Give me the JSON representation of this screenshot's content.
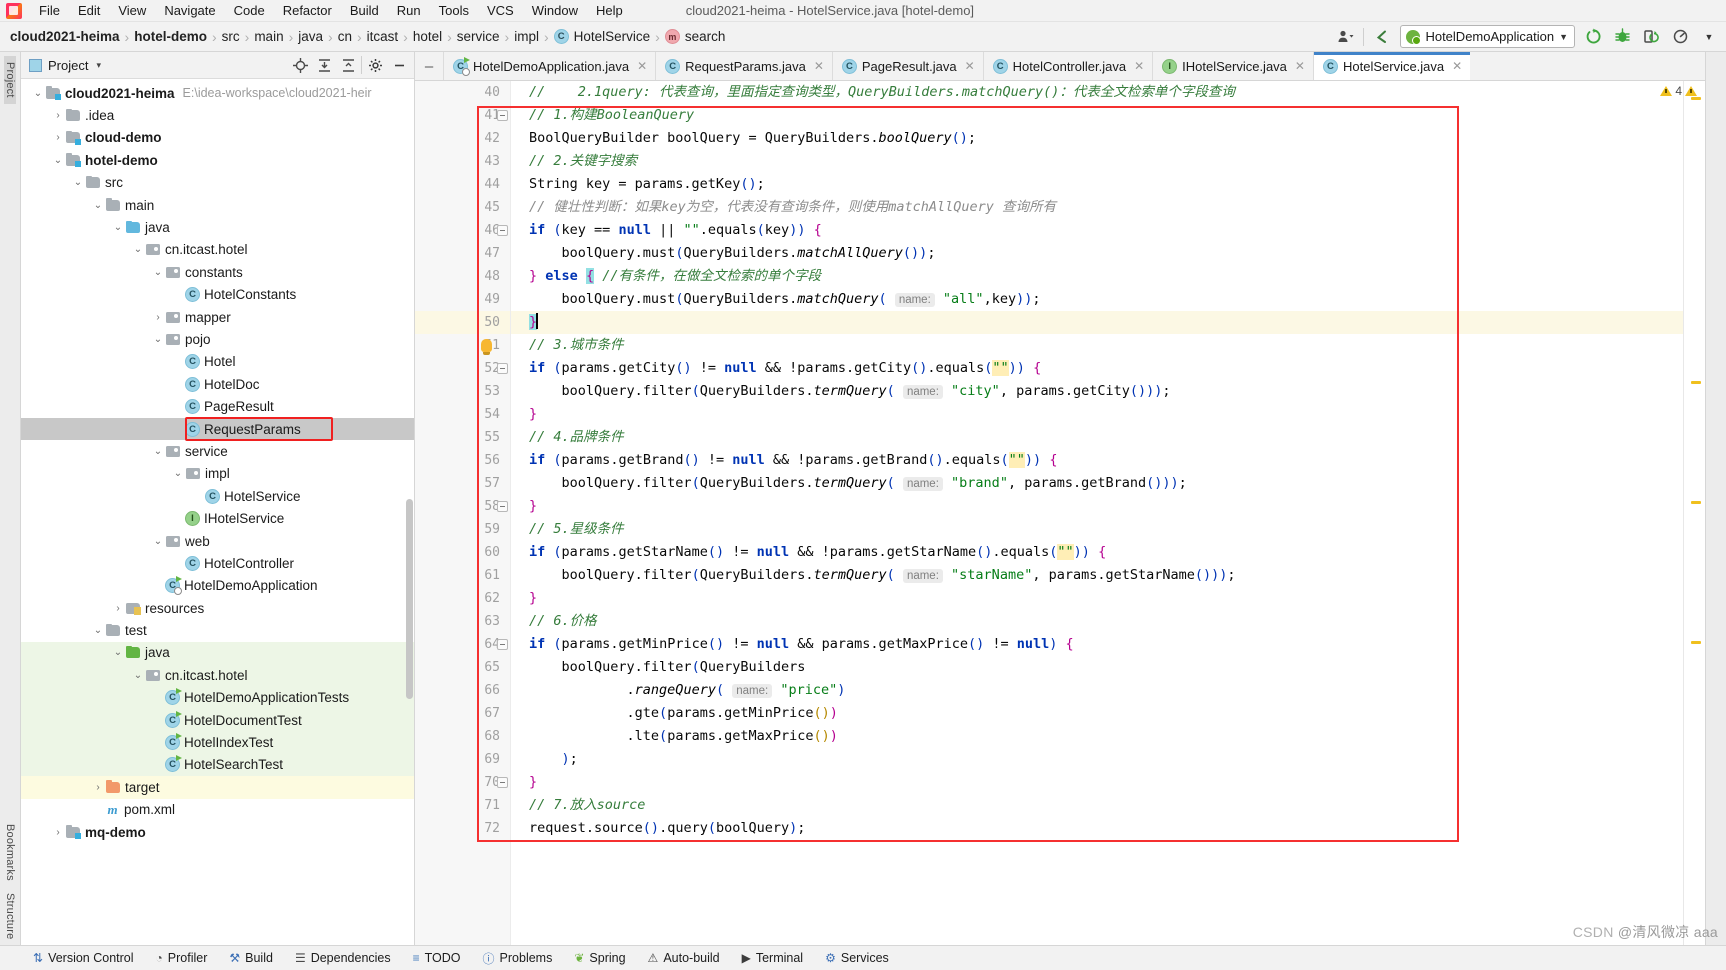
{
  "window": {
    "title": "cloud2021-heima - HotelService.java [hotel-demo]"
  },
  "menu": {
    "items": [
      "File",
      "Edit",
      "View",
      "Navigate",
      "Code",
      "Refactor",
      "Build",
      "Run",
      "Tools",
      "VCS",
      "Window",
      "Help"
    ]
  },
  "breadcrumb": {
    "items": [
      {
        "label": "cloud2021-heima",
        "bold": true,
        "icon": "none"
      },
      {
        "label": "hotel-demo",
        "bold": true,
        "icon": "none"
      },
      {
        "label": "src",
        "bold": false,
        "icon": "none"
      },
      {
        "label": "main",
        "bold": false,
        "icon": "none"
      },
      {
        "label": "java",
        "bold": false,
        "icon": "none"
      },
      {
        "label": "cn",
        "bold": false,
        "icon": "none"
      },
      {
        "label": "itcast",
        "bold": false,
        "icon": "none"
      },
      {
        "label": "hotel",
        "bold": false,
        "icon": "none"
      },
      {
        "label": "service",
        "bold": false,
        "icon": "none"
      },
      {
        "label": "impl",
        "bold": false,
        "icon": "none"
      },
      {
        "label": "HotelService",
        "bold": false,
        "icon": "class"
      },
      {
        "label": "search",
        "bold": false,
        "icon": "method"
      }
    ],
    "separator": "›"
  },
  "toolbar_right": {
    "run_configuration": "HotelDemoApplication",
    "dropdown_caret": "▼",
    "icons": [
      "user-dropdown-icon",
      "back-arrow-icon",
      "run-icon",
      "debug-icon",
      "run-coverage-icon",
      "profile-icon",
      "more-icon"
    ]
  },
  "project_panel": {
    "title": "Project",
    "dropdown_caret": "▾",
    "actions": [
      "locate-icon",
      "expand-all-icon",
      "collapse-all-icon",
      "settings-gear-icon",
      "hide-icon"
    ],
    "tree": [
      {
        "label": "cloud2021-heima",
        "indent": 0,
        "arrow": "⌄",
        "icon": "module",
        "bold": true,
        "path": "E:\\idea-workspace\\cloud2021-heir"
      },
      {
        "label": ".idea",
        "indent": 1,
        "arrow": "›",
        "icon": "folder",
        "bold": false
      },
      {
        "label": "cloud-demo",
        "indent": 1,
        "arrow": "›",
        "icon": "module",
        "bold": true
      },
      {
        "label": "hotel-demo",
        "indent": 1,
        "arrow": "⌄",
        "icon": "module",
        "bold": true
      },
      {
        "label": "src",
        "indent": 2,
        "arrow": "⌄",
        "icon": "folder",
        "bold": false
      },
      {
        "label": "main",
        "indent": 3,
        "arrow": "⌄",
        "icon": "folder",
        "bold": false
      },
      {
        "label": "java",
        "indent": 4,
        "arrow": "⌄",
        "icon": "src-folder",
        "bold": false
      },
      {
        "label": "cn.itcast.hotel",
        "indent": 5,
        "arrow": "⌄",
        "icon": "package",
        "bold": false
      },
      {
        "label": "constants",
        "indent": 6,
        "arrow": "⌄",
        "icon": "package",
        "bold": false
      },
      {
        "label": "HotelConstants",
        "indent": 7,
        "arrow": "",
        "icon": "class",
        "bold": false
      },
      {
        "label": "mapper",
        "indent": 6,
        "arrow": "›",
        "icon": "package",
        "bold": false
      },
      {
        "label": "pojo",
        "indent": 6,
        "arrow": "⌄",
        "icon": "package",
        "bold": false
      },
      {
        "label": "Hotel",
        "indent": 7,
        "arrow": "",
        "icon": "class",
        "bold": false
      },
      {
        "label": "HotelDoc",
        "indent": 7,
        "arrow": "",
        "icon": "class",
        "bold": false
      },
      {
        "label": "PageResult",
        "indent": 7,
        "arrow": "",
        "icon": "class",
        "bold": false
      },
      {
        "label": "RequestParams",
        "indent": 7,
        "arrow": "",
        "icon": "class",
        "bold": false,
        "selected": true,
        "highlighted": true
      },
      {
        "label": "service",
        "indent": 6,
        "arrow": "⌄",
        "icon": "package",
        "bold": false
      },
      {
        "label": "impl",
        "indent": 7,
        "arrow": "⌄",
        "icon": "package",
        "bold": false
      },
      {
        "label": "HotelService",
        "indent": 8,
        "arrow": "",
        "icon": "class",
        "bold": false
      },
      {
        "label": "IHotelService",
        "indent": 7,
        "arrow": "",
        "icon": "interface",
        "bold": false
      },
      {
        "label": "web",
        "indent": 6,
        "arrow": "⌄",
        "icon": "package",
        "bold": false
      },
      {
        "label": "HotelController",
        "indent": 7,
        "arrow": "",
        "icon": "class",
        "bold": false
      },
      {
        "label": "HotelDemoApplication",
        "indent": 6,
        "arrow": "",
        "icon": "springboot-class",
        "bold": false
      },
      {
        "label": "resources",
        "indent": 4,
        "arrow": "›",
        "icon": "resource-folder",
        "bold": false
      },
      {
        "label": "test",
        "indent": 3,
        "arrow": "⌄",
        "icon": "folder",
        "bold": false
      },
      {
        "label": "java",
        "indent": 4,
        "arrow": "⌄",
        "icon": "test-src-folder",
        "bold": false,
        "testsrc": true
      },
      {
        "label": "cn.itcast.hotel",
        "indent": 5,
        "arrow": "⌄",
        "icon": "package",
        "bold": false,
        "testsrc": true
      },
      {
        "label": "HotelDemoApplicationTests",
        "indent": 6,
        "arrow": "",
        "icon": "test-class",
        "bold": false,
        "testsrc": true
      },
      {
        "label": "HotelDocumentTest",
        "indent": 6,
        "arrow": "",
        "icon": "test-class",
        "bold": false,
        "testsrc": true
      },
      {
        "label": "HotelIndexTest",
        "indent": 6,
        "arrow": "",
        "icon": "test-class",
        "bold": false,
        "testsrc": true
      },
      {
        "label": "HotelSearchTest",
        "indent": 6,
        "arrow": "",
        "icon": "test-class",
        "bold": false,
        "testsrc": true
      },
      {
        "label": "target",
        "indent": 3,
        "arrow": "›",
        "icon": "target-folder",
        "bold": false,
        "target": true
      },
      {
        "label": "pom.xml",
        "indent": 3,
        "arrow": "",
        "icon": "maven",
        "bold": false
      },
      {
        "label": "mq-demo",
        "indent": 1,
        "arrow": "›",
        "icon": "module",
        "bold": true
      }
    ]
  },
  "left_rail": {
    "labels": [
      "Project",
      "Bookmarks",
      "Structure"
    ]
  },
  "editor_tabs": [
    {
      "label": "HotelDemoApplication.java",
      "icon": "springboot-class",
      "active": false
    },
    {
      "label": "RequestParams.java",
      "icon": "class",
      "active": false
    },
    {
      "label": "PageResult.java",
      "icon": "class",
      "active": false
    },
    {
      "label": "HotelController.java",
      "icon": "class",
      "active": false
    },
    {
      "label": "IHotelService.java",
      "icon": "interface",
      "active": false
    },
    {
      "label": "HotelService.java",
      "icon": "class",
      "active": true
    }
  ],
  "editor": {
    "first_line_number": 40,
    "current_line": 50,
    "inspection_warning_count": "4",
    "lines": [
      {
        "n": 40,
        "html": "<span class=\"cmg\">//    2.1query: 代表查询，里面指定查询类型，QueryBuilders.matchQuery()：代表全文检索单个字段查询</span>"
      },
      {
        "n": 41,
        "html": "<span class=\"cmg\">// 1.构建BooleanQuery</span>"
      },
      {
        "n": 42,
        "html": "BoolQueryBuilder boolQuery = QueryBuilders.<span class=\"mi\">boolQuery</span><span class=\"brc\">()</span>;"
      },
      {
        "n": 43,
        "html": "<span class=\"cmg\">// 2.关键字搜索</span>"
      },
      {
        "n": 44,
        "html": "String key = params.getKey<span class=\"brc\">()</span>;"
      },
      {
        "n": 45,
        "html": "<span class=\"cm\">// 健壮性判断：如果key为空，代表没有查询条件，则使用matchAllQuery 查询所有</span>"
      },
      {
        "n": 46,
        "html": "<span class=\"kw\">if</span> <span class=\"brc\">(</span>key == <span class=\"kw\">null</span> || <span class=\"st\">\"\"</span>.equals<span class=\"brc\">(</span>key<span class=\"brc\">))</span> <span class=\"pp\">{</span>"
      },
      {
        "n": 47,
        "html": "    boolQuery.must<span class=\"brc\">(</span>QueryBuilders.<span class=\"mi\">matchAllQuery</span><span class=\"brc\">())</span>;"
      },
      {
        "n": 48,
        "html": "<span class=\"pp\">}</span> <span class=\"kw\">else</span> <span class=\"sel-brace pp\">{</span> <span class=\"cmg\">//有条件，在做全文检索的单个字段</span>"
      },
      {
        "n": 49,
        "html": "    boolQuery.must<span class=\"brc\">(</span>QueryBuilders.<span class=\"mi\">matchQuery</span><span class=\"brc\">(</span> <span class=\"hint\">name:</span> <span class=\"st\">\"all\"</span>,key<span class=\"brc\">))</span>;"
      },
      {
        "n": 50,
        "html": "<span class=\"sel-brace pp\">}</span><span class=\"caret-bar\"></span>"
      },
      {
        "n": 51,
        "html": "<span class=\"cmg\">// 3.城市条件</span>"
      },
      {
        "n": 52,
        "html": "<span class=\"kw\">if</span> <span class=\"brc\">(</span>params.getCity<span class=\"brc\">()</span> != <span class=\"kw\">null</span> &amp;&amp; !params.getCity<span class=\"brc\">()</span>.equals<span class=\"brc\">(</span><span class=\"stt\">\"\"</span><span class=\"brc\">))</span> <span class=\"pp\">{</span>"
      },
      {
        "n": 53,
        "html": "    boolQuery.filter<span class=\"brc\">(</span>QueryBuilders.<span class=\"mi\">termQuery</span><span class=\"brc\">(</span> <span class=\"hint\">name:</span> <span class=\"st\">\"city\"</span>, params.getCity<span class=\"brc\">()))</span>;"
      },
      {
        "n": 54,
        "html": "<span class=\"pp\">}</span>"
      },
      {
        "n": 55,
        "html": "<span class=\"cmg\">// 4.品牌条件</span>"
      },
      {
        "n": 56,
        "html": "<span class=\"kw\">if</span> <span class=\"brc\">(</span>params.getBrand<span class=\"brc\">()</span> != <span class=\"kw\">null</span> &amp;&amp; !params.getBrand<span class=\"brc\">()</span>.equals<span class=\"brc\">(</span><span class=\"stt\">\"\"</span><span class=\"brc\">))</span> <span class=\"pp\">{</span>"
      },
      {
        "n": 57,
        "html": "    boolQuery.filter<span class=\"brc\">(</span>QueryBuilders.<span class=\"mi\">termQuery</span><span class=\"brc\">(</span> <span class=\"hint\">name:</span> <span class=\"st\">\"brand\"</span>, params.getBrand<span class=\"brc\">()))</span>;"
      },
      {
        "n": 58,
        "html": "<span class=\"pp\">}</span>"
      },
      {
        "n": 59,
        "html": "<span class=\"cmg\">// 5.星级条件</span>"
      },
      {
        "n": 60,
        "html": "<span class=\"kw\">if</span> <span class=\"brc\">(</span>params.getStarName<span class=\"brc\">()</span> != <span class=\"kw\">null</span> &amp;&amp; !params.getStarName<span class=\"brc\">()</span>.equals<span class=\"brc\">(</span><span class=\"stt\">\"\"</span><span class=\"brc\">))</span> <span class=\"pp\">{</span>"
      },
      {
        "n": 61,
        "html": "    boolQuery.filter<span class=\"brc\">(</span>QueryBuilders.<span class=\"mi\">termQuery</span><span class=\"brc\">(</span> <span class=\"hint\">name:</span> <span class=\"st\">\"starName\"</span>, params.getStarName<span class=\"brc\">()))</span>;"
      },
      {
        "n": 62,
        "html": "<span class=\"pp\">}</span>"
      },
      {
        "n": 63,
        "html": "<span class=\"cmg\">// 6.价格</span>"
      },
      {
        "n": 64,
        "html": "<span class=\"kw\">if</span> <span class=\"brc\">(</span>params.getMinPrice<span class=\"brc\">()</span> != <span class=\"kw\">null</span> &amp;&amp; params.getMaxPrice<span class=\"brc\">()</span> != <span class=\"kw\">null</span><span class=\"brc\">)</span> <span class=\"pp\">{</span>"
      },
      {
        "n": 65,
        "html": "    boolQuery.filter<span class=\"brc\">(</span>QueryBuilders"
      },
      {
        "n": 66,
        "html": "            .<span class=\"mi\">rangeQuery</span><span class=\"brc\">(</span> <span class=\"hint\">name:</span> <span class=\"st\">\"price\"</span><span class=\"brc\">)</span>"
      },
      {
        "n": 67,
        "html": "            .gte<span class=\"brc\">(</span>params.getMinPrice<span class=\"yl\">()</span><span class=\"pp\">)</span>"
      },
      {
        "n": 68,
        "html": "            .lte<span class=\"brc\">(</span>params.getMaxPrice<span class=\"yl\">()</span><span class=\"pp\">)</span>"
      },
      {
        "n": 69,
        "html": "    <span class=\"brc\">)</span>;"
      },
      {
        "n": 70,
        "html": "<span class=\"pp\">}</span>"
      },
      {
        "n": 71,
        "html": "<span class=\"cmg\">// 7.放入source</span>"
      },
      {
        "n": 72,
        "html": "request.source<span class=\"brc\">()</span>.query<span class=\"brc\">(</span>boolQuery<span class=\"brc\">)</span>;"
      }
    ]
  },
  "status_bar": {
    "items": [
      {
        "label": "Version Control",
        "icon": "branch-icon"
      },
      {
        "label": "Profiler",
        "icon": "profiler-icon"
      },
      {
        "label": "Build",
        "icon": "hammer-icon"
      },
      {
        "label": "Dependencies",
        "icon": "layers-icon"
      },
      {
        "label": "TODO",
        "icon": "list-icon"
      },
      {
        "label": "Problems",
        "icon": "error-icon"
      },
      {
        "label": "Spring",
        "icon": "spring-leaf-icon"
      },
      {
        "label": "Auto-build",
        "icon": "auto-build-icon"
      },
      {
        "label": "Terminal",
        "icon": "terminal-icon"
      },
      {
        "label": "Services",
        "icon": "services-icon"
      }
    ]
  },
  "watermark": {
    "csdn": "CSDN",
    "text": "@清风微凉 aaa"
  }
}
